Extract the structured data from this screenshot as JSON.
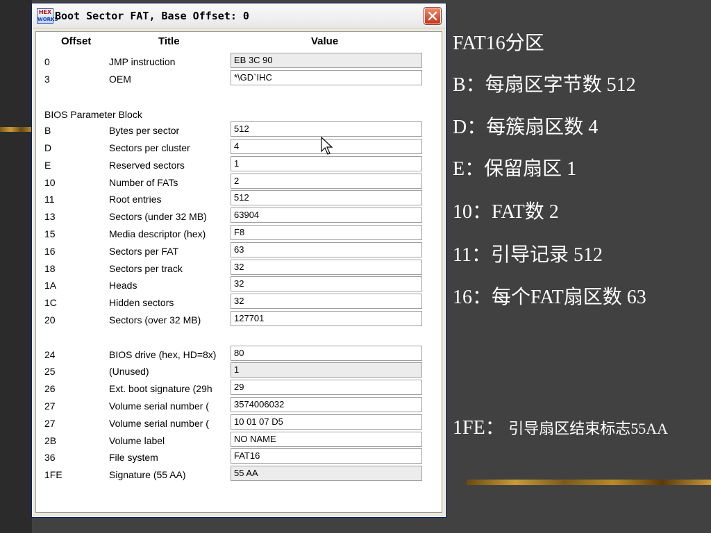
{
  "window": {
    "title": "Boot Sector FAT, Base Offset: 0",
    "icon_top": "HEX",
    "icon_bottom": "WORKS",
    "columns": {
      "offset": "Offset",
      "title": "Title",
      "value": "Value"
    }
  },
  "rows_group1": [
    {
      "offset": "0",
      "title": "JMP instruction",
      "value": "EB 3C 90",
      "readonly": true
    },
    {
      "offset": "3",
      "title": "OEM",
      "value": "*\\GD`IHC",
      "readonly": false
    }
  ],
  "section_label": "BIOS Parameter Block",
  "rows_bpb": [
    {
      "offset": "B",
      "title": "Bytes per sector",
      "value": "512"
    },
    {
      "offset": "D",
      "title": "Sectors per cluster",
      "value": "4"
    },
    {
      "offset": "E",
      "title": "Reserved sectors",
      "value": "1"
    },
    {
      "offset": "10",
      "title": "Number of FATs",
      "value": "2"
    },
    {
      "offset": "11",
      "title": "Root entries",
      "value": "512"
    },
    {
      "offset": "13",
      "title": "Sectors (under 32 MB)",
      "value": "63904"
    },
    {
      "offset": "15",
      "title": "Media descriptor (hex)",
      "value": "F8"
    },
    {
      "offset": "16",
      "title": "Sectors per FAT",
      "value": "63"
    },
    {
      "offset": "18",
      "title": "Sectors per track",
      "value": "32"
    },
    {
      "offset": "1A",
      "title": "Heads",
      "value": "32"
    },
    {
      "offset": "1C",
      "title": "Hidden sectors",
      "value": "32"
    },
    {
      "offset": "20",
      "title": "Sectors (over 32 MB)",
      "value": "127701"
    }
  ],
  "rows_ext": [
    {
      "offset": "24",
      "title": "BIOS drive (hex, HD=8x)",
      "value": "80",
      "readonly": false
    },
    {
      "offset": "25",
      "title": "(Unused)",
      "value": "1",
      "readonly": true
    },
    {
      "offset": "26",
      "title": "Ext. boot signature (29h",
      "value": "29",
      "readonly": false
    },
    {
      "offset": "27",
      "title": "Volume serial number (",
      "value": "3574006032",
      "readonly": false
    },
    {
      "offset": "27",
      "title": "Volume serial number (",
      "value": "10 01 07 D5",
      "readonly": false
    },
    {
      "offset": "2B",
      "title": "Volume label",
      "value": "NO NAME",
      "readonly": false
    },
    {
      "offset": "36",
      "title": "File system",
      "value": "FAT16",
      "readonly": false
    },
    {
      "offset": "1FE",
      "title": "Signature (55 AA)",
      "value": "55 AA",
      "readonly": true
    }
  ],
  "notes": [
    "FAT16分区",
    "B：每扇区字节数 512",
    "D：每簇扇区数  4",
    "E：保留扇区  1",
    "10：FAT数   2",
    "11：引导记录  512",
    "16：每个FAT扇区数  63"
  ],
  "note_last": {
    "prefix": "1FE：",
    "text": " 引导扇区结束标志55AA"
  },
  "colors": {
    "background": "#414141",
    "window_border": "#0a246a",
    "close": "#c9341a"
  }
}
